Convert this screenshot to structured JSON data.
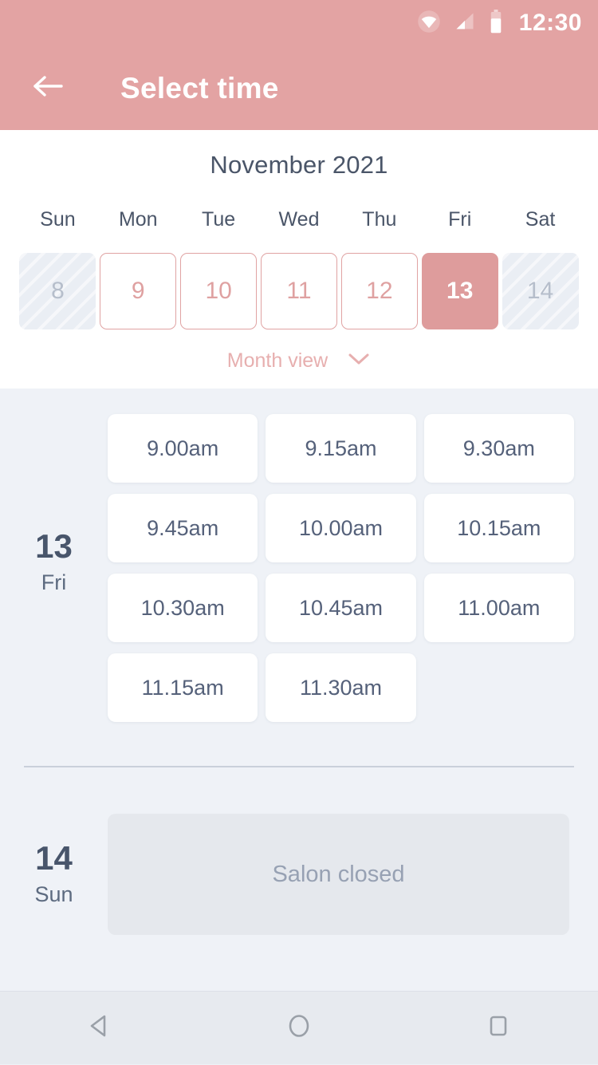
{
  "status_bar": {
    "time": "12:30",
    "icons": [
      "wifi-icon",
      "signal-icon",
      "battery-icon"
    ]
  },
  "app_bar": {
    "back_icon": "arrow-left-icon",
    "title": "Select time",
    "background_color": "#E3A3A3"
  },
  "calendar": {
    "month_title": "November 2021",
    "weekday_headers": [
      "Sun",
      "Mon",
      "Tue",
      "Wed",
      "Thu",
      "Fri",
      "Sat"
    ],
    "days": [
      {
        "number": "8",
        "state": "disabled"
      },
      {
        "number": "9",
        "state": "available"
      },
      {
        "number": "10",
        "state": "available"
      },
      {
        "number": "11",
        "state": "available"
      },
      {
        "number": "12",
        "state": "available"
      },
      {
        "number": "13",
        "state": "selected"
      },
      {
        "number": "14",
        "state": "disabled"
      }
    ],
    "month_view_label": "Month view",
    "month_view_icon": "chevron-down-icon",
    "accent_color": "#DE9C9C",
    "outline_color": "#E0A3A3"
  },
  "schedule": [
    {
      "day_number": "13",
      "weekday": "Fri",
      "slots": [
        "9.00am",
        "9.15am",
        "9.30am",
        "9.45am",
        "10.00am",
        "10.15am",
        "10.30am",
        "10.45am",
        "11.00am",
        "11.15am",
        "11.30am"
      ],
      "closed": false
    },
    {
      "day_number": "14",
      "weekday": "Sun",
      "slots": [],
      "closed": true,
      "closed_message": "Salon closed"
    }
  ],
  "nav_bar": {
    "buttons": [
      "back-triangle-icon",
      "home-circle-icon",
      "recents-square-icon"
    ]
  },
  "colors": {
    "page_background": "#EFF2F7",
    "card_background": "#FFFFFF",
    "text_dark": "#4A5568",
    "text_muted": "#97A1B3"
  }
}
